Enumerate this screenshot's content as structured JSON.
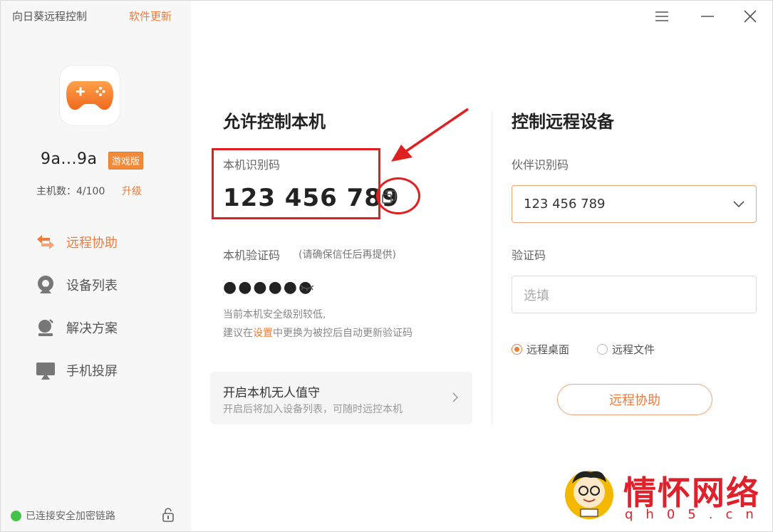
{
  "app": {
    "title": "向日葵远程控制",
    "update_label": "软件更新"
  },
  "profile": {
    "username": "9a...9a",
    "edition": "游戏版",
    "host_count": "主机数：4/100",
    "upgrade_label": "升级"
  },
  "nav": [
    {
      "label": "远程协助",
      "icon": "remote-assist-icon",
      "active": true
    },
    {
      "label": "设备列表",
      "icon": "device-list-icon"
    },
    {
      "label": "解决方案",
      "icon": "solution-icon"
    },
    {
      "label": "手机投屏",
      "icon": "screen-cast-icon"
    }
  ],
  "status": {
    "text": "已连接安全加密链路"
  },
  "allow": {
    "title": "允许控制本机",
    "id_label": "本机识别码",
    "id_code": "123 456 789",
    "verify_label": "本机验证码",
    "verify_note": "(请确保信任后再提供)",
    "verify_masked": "●●●●●●",
    "warn_line1": "当前本机安全级别较低,",
    "warn_line2_pre": "建议在",
    "warn_link": "设置",
    "warn_line2_post": "中更换为被控后自动更新验证码",
    "unattended_title": "开启本机无人值守",
    "unattended_desc": "开启后将加入设备列表，可随时远控本机"
  },
  "control": {
    "title": "控制远程设备",
    "partner_label": "伙伴识别码",
    "partner_value": "123 456 789",
    "code_label": "验证码",
    "code_placeholder": "选填",
    "radio_desktop": "远程桌面",
    "radio_file": "远程文件",
    "button": "远程协助"
  },
  "watermark": {
    "text": "情怀网络",
    "sub": "qh05.cn"
  },
  "colors": {
    "accent": "#f07b3a",
    "annotation": "#e02020",
    "status_ok": "#44c24a"
  }
}
